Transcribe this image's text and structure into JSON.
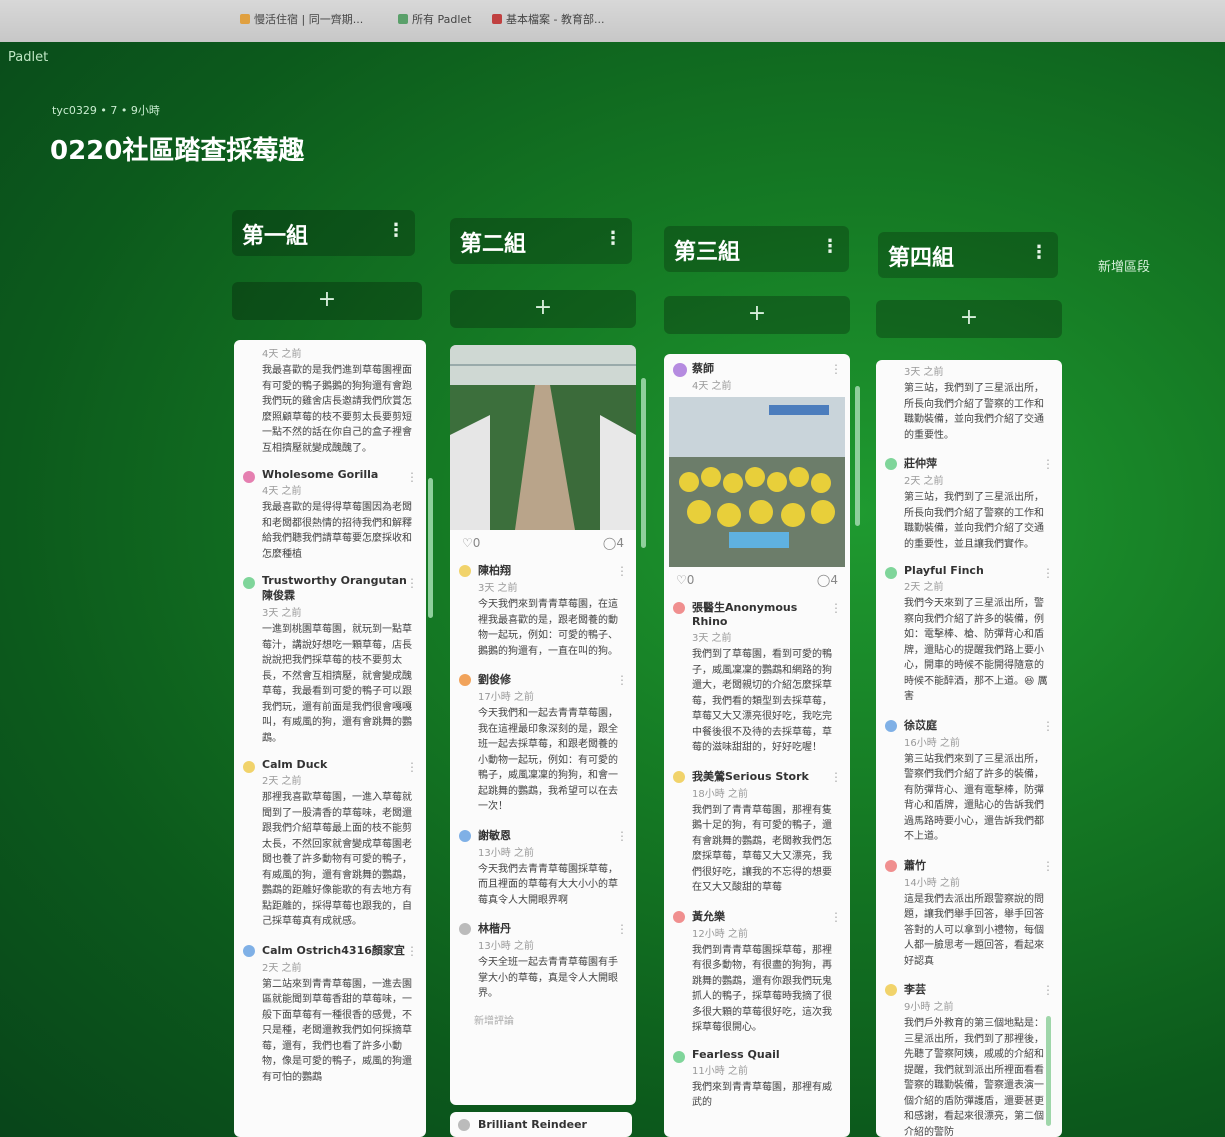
{
  "browser": {
    "bookmarks": [
      "慢活住宿 | 同一齊期...",
      "所有 Padlet",
      "基本檔案 - 教育部..."
    ]
  },
  "app": {
    "name": "Padlet"
  },
  "board": {
    "meta": "tyc0329 • 7 • 9小時",
    "title": "0220社區踏查採莓趣",
    "new_section": "新增區段"
  },
  "columns": [
    {
      "title": "第一組",
      "menu": "⋮",
      "add": "+"
    },
    {
      "title": "第二組",
      "menu": "⋮",
      "add": "+"
    },
    {
      "title": "第三組",
      "menu": "⋮",
      "add": "+"
    },
    {
      "title": "第四組",
      "menu": "⋮",
      "add": "+"
    }
  ],
  "col1": {
    "posts": [
      {
        "author": "",
        "time": "4天 之前",
        "body": "我最喜歡的是我們進到草莓園裡面有可愛的鴨子鵝鵝的狗狗還有會跑我們玩的雞舍店長邀請我們欣賞怎麼照顧草莓的枝不要剪太長要剪短一點不然的話在你自己的盒子裡會互相擠壓就變成醜醜了。",
        "color": "#e9b6c6"
      },
      {
        "author": "Wholesome Gorilla",
        "time": "4天 之前",
        "body": "我最喜歡的是得得草莓園因為老闆和老闆都很熱情的招待我們和解釋給我們聽我們請草莓要怎麼採收和怎麼種植",
        "color": "#e57fb0"
      },
      {
        "author": "Trustworthy Orangutan陳俊霖",
        "time": "3天 之前",
        "body": "一進到桃園草莓園，就玩到一點草莓汁，講說好想吃一顆草莓，店長說說把我們採草莓的枝不要剪太長，不然會互相擠壓，就會變成醜草莓，我最看到可愛的鴨子可以跟我們玩，還有前面是我們很會嘎嘎叫，有威風的狗，還有會跳舞的鸚鵡。",
        "color": "#7fd59a"
      },
      {
        "author": "Calm Duck",
        "time": "2天 之前",
        "body": "那裡我喜歡草莓園，一進入草莓就聞到了一股清香的草莓味，老闆還跟我們介紹草莓最上面的枝不能剪太長，不然回家就會變成草莓園老闆也養了許多動物有可愛的鴨子，有威風的狗，還有會跳舞的鸚鵡，鸚鵡的距離好像能歌的有去地方有點距離的，採得草莓也跟我的，自己採草莓真有成就感。",
        "color": "#f1d36b"
      },
      {
        "author": "Calm Ostrich4316顏家宜",
        "time": "2天 之前",
        "body": "第二站來到青青草莓園，一進去園區就能聞到草莓香甜的草莓味，一般下面草莓有一種很香的感覺，不只是種，老闆還教我們如何採摘草莓，還有，我們也看了許多小動物，像是可愛的鴨子，威風的狗還有可怕的鸚鵡",
        "color": "#7fb0e6"
      }
    ]
  },
  "col2": {
    "likes": "♡0",
    "comments": "◯4",
    "posts": [
      {
        "author": "陳柏翔",
        "time": "3天 之前",
        "body": "今天我們來到青青草莓園，在這裡我最喜歡的是，跟老闆養的動物一起玩，例如：可愛的鴨子、鵝鵝的狗還有，一直在叫的狗。",
        "color": "#f1d36b"
      },
      {
        "author": "劉俊修",
        "time": "17小時 之前",
        "body": "今天我們和一起去青青草莓園，我在這裡最印象深刻的是，跟全班一起去採草莓，和跟老闆養的小動物一起玩，例如：有可愛的鴨子，威風凜凜的狗狗，和會一起跳舞的鸚鵡，我希望可以在去一次！",
        "color": "#f1a35b"
      },
      {
        "author": "謝敏恩",
        "time": "13小時 之前",
        "body": "今天我們去青青草莓園採草莓，而且裡面的草莓有大大小小的草莓真令人大開眼界啊",
        "color": "#7fb0e6"
      },
      {
        "author": "林楷丹",
        "time": "13小時 之前",
        "body": "今天全班一起去青青草莓園有手掌大小的草莓，真是令人大開眼界。",
        "color": "#bbbbbb"
      }
    ],
    "add_comment": "新增評論",
    "next_author": "Brilliant Reindeer"
  },
  "col3": {
    "top_author": "蔡師",
    "top_time": "4天 之前",
    "likes": "♡0",
    "comments": "◯4",
    "posts": [
      {
        "author": "張醫生Anonymous Rhino",
        "time": "3天 之前",
        "body": "我們到了草莓園，看到可愛的鴨子，威風凜凜的鸚鵡和網路的狗還大，老闆親切的介紹怎麼採草莓，我們看的類型到去採草莓，草莓又大又漂亮很好吃，我吃完中餐後很不及待的去採草莓，草莓的滋味甜甜的，好好吃喔！",
        "color": "#f08f8f"
      },
      {
        "author": "我美鶯Serious Stork",
        "time": "18小時 之前",
        "body": "我們到了青青草莓園，那裡有隻鵝十足的狗，有可愛的鴨子，還有會跳舞的鸚鵡，老闆教我們怎麼採草莓，草莓又大又漂亮，我們很好吃，讓我的不忘得的想要在又大又酸甜的草莓",
        "color": "#f1d36b"
      },
      {
        "author": "黃允樂",
        "time": "12小時 之前",
        "body": "我們到青青草莓園採草莓，那裡有很多動物，有很盡的狗狗，再跳舞的鸚鵡，還有你跟我們玩鬼抓人的鴨子，採草莓時我摘了很多很大顆的草莓很好吃，這次我採草莓很開心。",
        "color": "#f08f8f"
      },
      {
        "author": "Fearless Quail",
        "time": "11小時 之前",
        "body": "我們來到青青草莓園，那裡有威武的",
        "color": "#7fd59a"
      }
    ]
  },
  "col4": {
    "posts": [
      {
        "author": "",
        "time": "3天 之前",
        "body": "第三站，我們到了三星派出所，所長向我們介紹了警察的工作和職勤裝備，並向我們介紹了交通的重要性。",
        "color": "#dddddd"
      },
      {
        "author": "莊仲萍",
        "time": "2天 之前",
        "body": "第三站，我們到了三星派出所，所長向我們介紹了警察的工作和職勤裝備，並向我們介紹了交通的重要性，並且讓我們實作。",
        "color": "#7fd59a"
      },
      {
        "author": "Playful Finch",
        "time": "2天 之前",
        "body": "我們今天來到了三星派出所，警察向我們介紹了許多的裝備，例如：電擊棒、槍、防彈背心和盾牌，還貼心的提醒我們路上要小心，開車的時候不能開得隨意的時候不能醉酒，那不上道。😆 厲害",
        "color": "#7fd59a"
      },
      {
        "author": "徐苡庭",
        "time": "16小時 之前",
        "body": "第三站我們來到了三星派出所，警察們我們介紹了許多的裝備，有防彈背心、還有電擊棒，防彈背心和盾牌，還貼心的告訴我們過馬路時要小心，還告訴我們都不上道。",
        "color": "#7fb0e6"
      },
      {
        "author": "蕭竹",
        "time": "14小時 之前",
        "body": "這是我們去派出所跟警察說的問題，讓我們舉手回答，舉手回答答對的人可以拿到小禮物，每個人都一臉思考一題回答，看起來好認真",
        "color": "#f08f8f"
      },
      {
        "author": "李芸",
        "time": "9小時 之前",
        "body": "我們戶外教育的第三個地點是：三星派出所，我們到了那裡後，先聽了警察阿姨，戚戚的介紹和提醒，我們就到派出所裡面看看警察的職勤裝備，警察還表演一個介紹的盾防彈護盾，還要甚更和感謝，看起來很漂亮，第二個介紹的警防",
        "color": "#f1d36b"
      }
    ]
  }
}
